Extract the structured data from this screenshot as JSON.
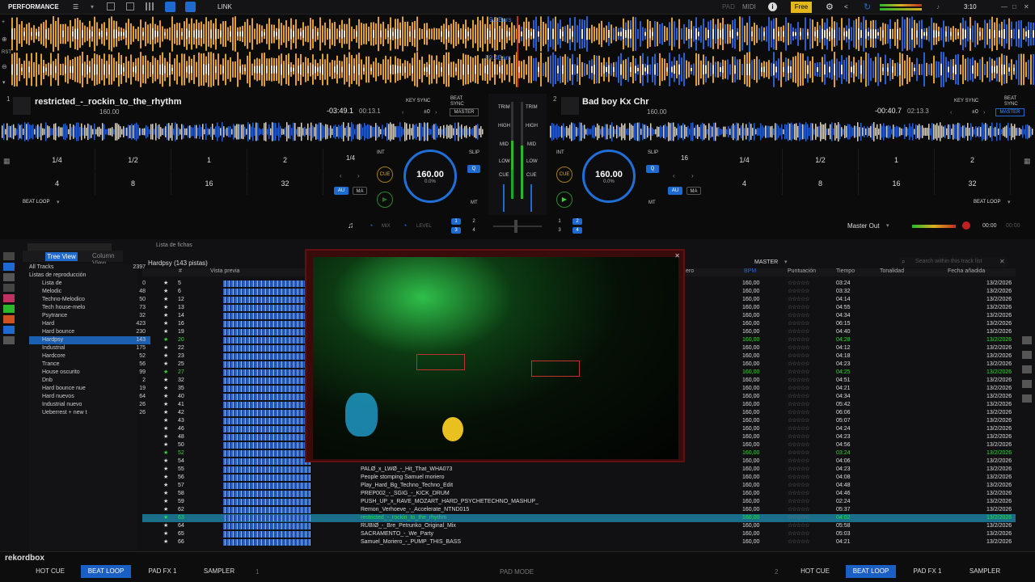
{
  "topbar": {
    "mode": "PERFORMANCE",
    "link": "LINK",
    "pad": "PAD",
    "midi": "MIDI",
    "free": "Free",
    "time": "3:10"
  },
  "waveform": {
    "deck1_bars": "9.1Bars",
    "deck2_bars": "89.4Bars",
    "rst": "RST"
  },
  "deck1": {
    "num": "1",
    "title": "restricted_-_rockin_to_the_rhythm",
    "bpm": "160.00",
    "remain": "-03:49.1",
    "elapsed": "00:13.1",
    "key_sync": "KEY SYNC",
    "beat_sync": "BEAT SYNC",
    "key_offset": "±0",
    "master": "MASTER",
    "tempo_pct": "0.0%",
    "tempo_range": "±6",
    "loop_display": "1/4",
    "int": "INT",
    "slip": "SLIP",
    "q": "Q",
    "au": "AU",
    "ma": "MA",
    "mt": "MT",
    "cue": "CUE",
    "beat_loop": "BEAT LOOP",
    "pads": [
      "1/4",
      "1/2",
      "1",
      "2",
      "4",
      "8",
      "16",
      "32"
    ]
  },
  "deck2": {
    "num": "2",
    "title": "Bad boy Kx Chr",
    "bpm": "160.00",
    "remain": "-00:40.7",
    "elapsed": "02:13.3",
    "key_sync": "KEY SYNC",
    "beat_sync": "BEAT SYNC",
    "key_offset": "±0",
    "master": "MASTER",
    "tempo_pct": "0.0%",
    "tempo_range": "±6",
    "loop_display": "16",
    "int": "INT",
    "slip": "SLIP",
    "q": "Q",
    "au": "AU",
    "ma": "MA",
    "mt": "MT",
    "cue": "CUE",
    "beat_loop": "BEAT LOOP",
    "pads": [
      "1/4",
      "1/2",
      "1",
      "2",
      "4",
      "8",
      "16",
      "32"
    ]
  },
  "mixer": {
    "trim": "TRIM",
    "high": "HIGH",
    "mid": "MID",
    "low": "LOW",
    "cue": "CUE",
    "mix": "MIX",
    "level": "LEVEL",
    "master_out": "Master Out",
    "rec_time": "00:00",
    "rec_total": "00:00"
  },
  "browser": {
    "panel_title": "Lista de fichas",
    "tree_view": "Tree View",
    "column_view": "Column View",
    "playlist_header": "Hardpsy (143 pistas)",
    "search_placeholder": "Search within this track list",
    "master": "MASTER",
    "tree": [
      {
        "label": "All Tracks",
        "count": "2397"
      },
      {
        "label": "Listas de reproducción",
        "count": ""
      },
      {
        "label": "Lista de",
        "count": "0"
      },
      {
        "label": "Melodic",
        "count": "48"
      },
      {
        "label": "Techno-Melodico",
        "count": "50"
      },
      {
        "label": "Tech house-melo",
        "count": "73"
      },
      {
        "label": "Psytrance",
        "count": "32"
      },
      {
        "label": "Hard",
        "count": "423"
      },
      {
        "label": "Hard bounce",
        "count": "230"
      },
      {
        "label": "Hardpsy",
        "count": "143"
      },
      {
        "label": "Industrial",
        "count": "175"
      },
      {
        "label": "Hardcore",
        "count": "52"
      },
      {
        "label": "Trance",
        "count": "56"
      },
      {
        "label": "House oscurito",
        "count": "99"
      },
      {
        "label": "Dnb",
        "count": "2"
      },
      {
        "label": "Hard bounce nue",
        "count": "19"
      },
      {
        "label": "Hard nuevos",
        "count": "64"
      },
      {
        "label": "Industrial nuevo",
        "count": "26"
      },
      {
        "label": "Ueberrest + new t",
        "count": "26"
      }
    ],
    "columns": {
      "num": "#",
      "preview": "Vista previa",
      "title": "ero",
      "bpm": "BPM",
      "rating": "Puntuación",
      "time": "Tiempo",
      "key": "Tonalidad",
      "date": "Fecha añadida"
    },
    "rows": [
      {
        "num": "5",
        "title": "",
        "bpm": "160,00",
        "time": "03:24",
        "date": "13/2/2026",
        "state": ""
      },
      {
        "num": "6",
        "title": "",
        "bpm": "160,00",
        "time": "03:32",
        "date": "13/2/2026",
        "state": ""
      },
      {
        "num": "12",
        "title": "",
        "bpm": "160,00",
        "time": "04:14",
        "date": "13/2/2026",
        "state": ""
      },
      {
        "num": "13",
        "title": "",
        "bpm": "160,00",
        "time": "04:55",
        "date": "13/2/2026",
        "state": ""
      },
      {
        "num": "14",
        "title": "",
        "bpm": "160,00",
        "time": "04:34",
        "date": "13/2/2026",
        "state": ""
      },
      {
        "num": "16",
        "title": "",
        "bpm": "160,00",
        "time": "06:15",
        "date": "13/2/2026",
        "state": ""
      },
      {
        "num": "19",
        "title": "",
        "bpm": "160,00",
        "time": "04:40",
        "date": "13/2/2026",
        "state": ""
      },
      {
        "num": "20",
        "title": "",
        "bpm": "160,00",
        "time": "04:28",
        "date": "13/2/2026",
        "state": "gr"
      },
      {
        "num": "22",
        "title": "",
        "bpm": "160,00",
        "time": "04:12",
        "date": "13/2/2026",
        "state": ""
      },
      {
        "num": "23",
        "title": "",
        "bpm": "160,00",
        "time": "04:18",
        "date": "13/2/2026",
        "state": ""
      },
      {
        "num": "25",
        "title": "",
        "bpm": "160,00",
        "time": "04:23",
        "date": "13/2/2026",
        "state": ""
      },
      {
        "num": "27",
        "title": "",
        "bpm": "160,00",
        "time": "04:25",
        "date": "13/2/2026",
        "state": "gr"
      },
      {
        "num": "32",
        "title": "",
        "bpm": "160,00",
        "time": "04:51",
        "date": "13/2/2026",
        "state": ""
      },
      {
        "num": "35",
        "title": "",
        "bpm": "160,00",
        "time": "04:21",
        "date": "13/2/2026",
        "state": ""
      },
      {
        "num": "40",
        "title": "",
        "bpm": "160,00",
        "time": "04:34",
        "date": "13/2/2026",
        "state": ""
      },
      {
        "num": "41",
        "title": "",
        "bpm": "160,00",
        "time": "05:42",
        "date": "13/2/2026",
        "state": ""
      },
      {
        "num": "42",
        "title": "",
        "bpm": "160,00",
        "time": "06:06",
        "date": "13/2/2026",
        "state": ""
      },
      {
        "num": "43",
        "title": "",
        "bpm": "160,00",
        "time": "05:07",
        "date": "13/2/2026",
        "state": ""
      },
      {
        "num": "46",
        "title": "",
        "bpm": "160,00",
        "time": "04:24",
        "date": "13/2/2026",
        "state": ""
      },
      {
        "num": "48",
        "title": "",
        "bpm": "160,00",
        "time": "04:23",
        "date": "13/2/2026",
        "state": ""
      },
      {
        "num": "50",
        "title": "",
        "bpm": "160,00",
        "time": "04:56",
        "date": "13/2/2026",
        "state": ""
      },
      {
        "num": "52",
        "title": "",
        "bpm": "160,00",
        "time": "03:24",
        "date": "13/2/2026",
        "state": "gr"
      },
      {
        "num": "54",
        "title": "",
        "bpm": "160,00",
        "time": "04:06",
        "date": "13/2/2026",
        "state": ""
      },
      {
        "num": "55",
        "title": "PALØ_x_LWØ_-_Hit_That_WHA073",
        "bpm": "160,00",
        "time": "04:23",
        "date": "13/2/2026",
        "state": ""
      },
      {
        "num": "56",
        "title": "People stomping Samuel moriero",
        "bpm": "160,00",
        "time": "04:08",
        "date": "13/2/2026",
        "state": ""
      },
      {
        "num": "57",
        "title": "Play_Hard_Bg_Techno_Techno_Edit",
        "bpm": "160,00",
        "time": "04:48",
        "date": "13/2/2026",
        "state": ""
      },
      {
        "num": "58",
        "title": "PREP002_-_SGIG_-_KICK_DRUM",
        "bpm": "160,00",
        "time": "04:46",
        "date": "13/2/2026",
        "state": ""
      },
      {
        "num": "59",
        "title": "PUSH_UP_x_RAVE_MOZART_HARD_PSYCHETECHNO_MASHUP_",
        "bpm": "160,00",
        "time": "02:24",
        "date": "13/2/2026",
        "state": ""
      },
      {
        "num": "62",
        "title": "Remon_Verhoeve_-_Accelerate_NTND015",
        "bpm": "160,00",
        "time": "05:37",
        "date": "13/2/2026",
        "state": ""
      },
      {
        "num": "63",
        "title": "restricted_-_rockin_to_the_rhythm",
        "bpm": "160,00",
        "time": "04:02",
        "date": "13/2/2026",
        "state": "hl"
      },
      {
        "num": "64",
        "title": "RUBIØ_-_Bre_Petrunko_Original_Mix",
        "bpm": "160,00",
        "time": "05:58",
        "date": "13/2/2026",
        "state": ""
      },
      {
        "num": "65",
        "title": "SACRAMENTO_-_We_Party",
        "bpm": "160,00",
        "time": "05:03",
        "date": "13/2/2026",
        "state": ""
      },
      {
        "num": "66",
        "title": "Samuel_Moriero_-_PUMP_THIS_BASS",
        "bpm": "160,00",
        "time": "04:21",
        "date": "13/2/2026",
        "state": ""
      }
    ]
  },
  "bottom": {
    "logo": "rekordbox",
    "hot_cue": "HOT CUE",
    "beat_loop": "BEAT LOOP",
    "pad_fx": "PAD FX 1",
    "sampler": "SAMPLER",
    "pad_mode": "PAD MODE",
    "deck1": "1",
    "deck2": "2"
  },
  "colors": {
    "accent": "#1e6ad0",
    "wave_orange": "#e0a030",
    "wave_blue": "#2a5fcf",
    "play_green": "#3ccf3c"
  }
}
